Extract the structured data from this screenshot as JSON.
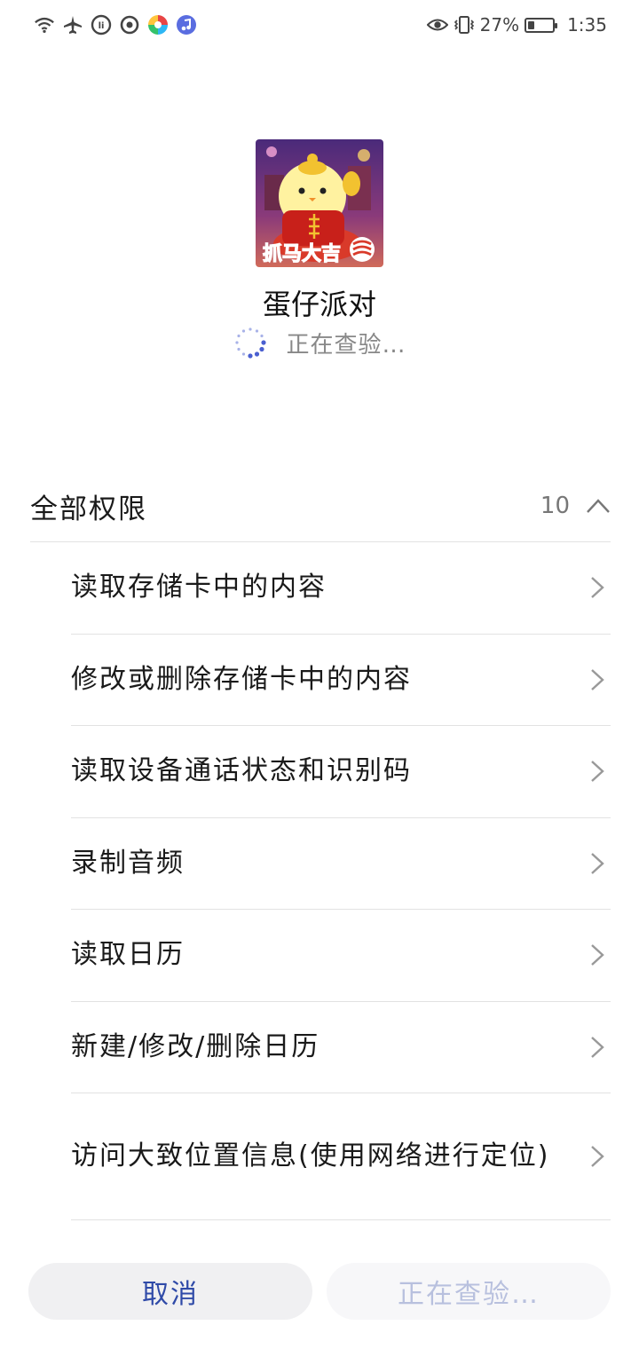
{
  "status_bar": {
    "battery_percent": "27%",
    "battery_level": 0.27,
    "time": "1:35",
    "icons_left": [
      "wifi-icon",
      "airplane-icon",
      "app-notif-icon-1",
      "app-notif-icon-2",
      "app-notif-icon-3",
      "app-notif-icon-4"
    ],
    "icons_right": [
      "eye-icon",
      "vibrate-icon",
      "battery-icon"
    ]
  },
  "app": {
    "name": "蛋仔派对",
    "status": "正在查验…",
    "icon_name": "eggy-party-app-icon"
  },
  "permissions": {
    "title": "全部权限",
    "count": "10",
    "items": [
      {
        "label": "读取存储卡中的内容"
      },
      {
        "label": "修改或删除存储卡中的内容"
      },
      {
        "label": "读取设备通话状态和识别码"
      },
      {
        "label": "录制音频"
      },
      {
        "label": "读取日历"
      },
      {
        "label": "新建/修改/删除日历"
      },
      {
        "label": "访问大致位置信息(使用网络进行定位)"
      }
    ]
  },
  "buttons": {
    "cancel": "取消",
    "checking": "正在查验…"
  },
  "colors": {
    "accent": "#2f4aa8",
    "disabled_text": "#b8c0de",
    "divider": "#e2e2e2",
    "muted_text": "#888888"
  }
}
